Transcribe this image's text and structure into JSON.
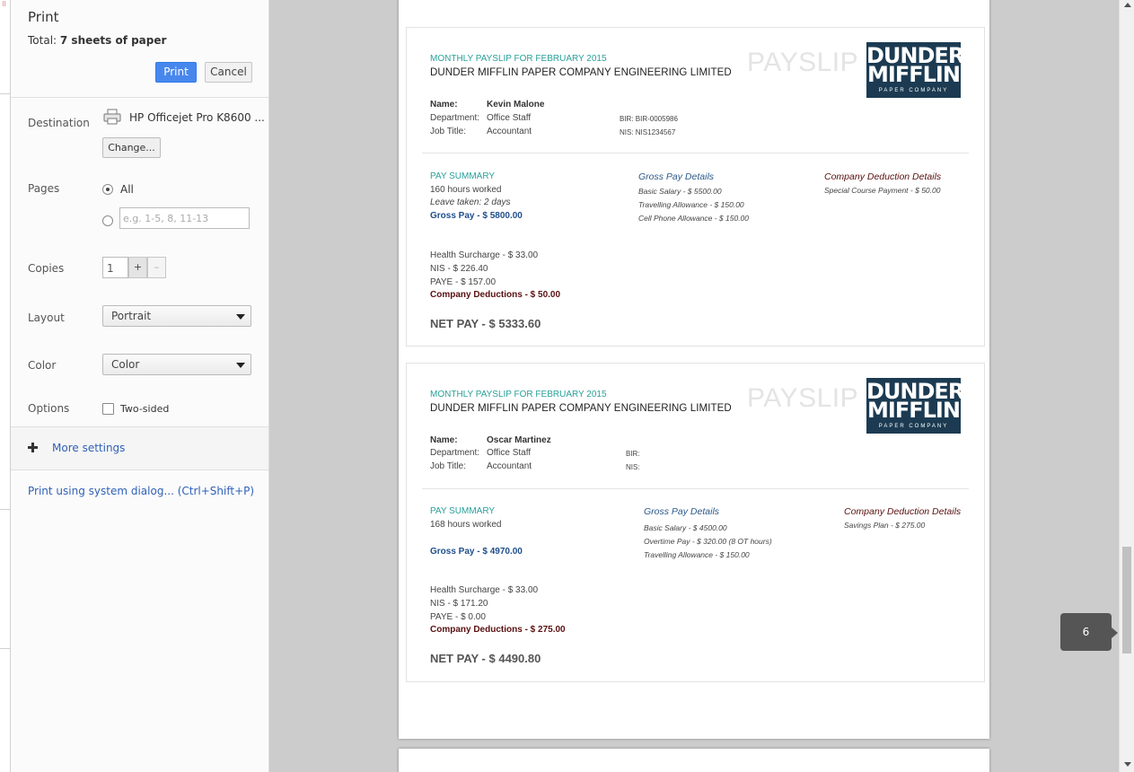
{
  "dialog": {
    "title": "Print",
    "total_label": "Total:",
    "total_value": "7 sheets of paper",
    "print_label": "Print",
    "cancel_label": "Cancel"
  },
  "destination": {
    "label": "Destination",
    "printer": "HP Officejet Pro K8600 ...",
    "change_label": "Change..."
  },
  "pages": {
    "label": "Pages",
    "option_all": "All",
    "custom_placeholder": "e.g. 1-5, 8, 11-13",
    "selected": "All"
  },
  "copies": {
    "label": "Copies",
    "value": "1",
    "plus": "+",
    "minus": "–"
  },
  "layout": {
    "label": "Layout",
    "value": "Portrait"
  },
  "color": {
    "label": "Color",
    "value": "Color"
  },
  "options": {
    "label": "Options",
    "two_sided": "Two-sided",
    "two_sided_checked": false
  },
  "more_settings": "More settings",
  "system_dialog": "Print using system dialog... (Ctrl+Shift+P)",
  "preview": {
    "current_page": "6",
    "slips": [
      {
        "month": "MONTHLY PAYSLIP FOR FEBRUARY 2015",
        "company": "DUNDER MIFFLIN PAPER COMPANY ENGINEERING LIMITED",
        "payslip_word": "PAYSLIP",
        "logo": {
          "line1": "DUNDER",
          "line2": "MIFFLIN",
          "line3": "PAPER COMPANY"
        },
        "name_label": "Name:",
        "name": "Kevin Malone",
        "dept_label": "Department:",
        "dept": "Office Staff",
        "job_label": "Job Title:",
        "job": "Accountant",
        "bir": "BIR: BIR-0005986",
        "nis": "NIS: NIS1234567",
        "pay_summary": "PAY SUMMARY",
        "hours": "160 hours worked",
        "leave": "Leave taken: 2 days",
        "gross_pay": "Gross Pay - $ 5800.00",
        "gross_header": "Gross Pay Details",
        "gross_items": [
          "Basic Salary - $ 5500.00",
          "Travelling Allowance - $ 150.00",
          "Cell Phone Allowance - $ 150.00"
        ],
        "ded_header": "Company Deduction Details",
        "ded_items": [
          "Special Course Payment - $ 50.00"
        ],
        "health": "Health Surcharge - $ 33.00",
        "nis_amt": "NIS - $ 226.40",
        "paye": "PAYE - $ 157.00",
        "company_ded": "Company Deductions - $ 50.00",
        "net_pay": "NET PAY - $ 5333.60"
      },
      {
        "month": "MONTHLY PAYSLIP FOR FEBRUARY 2015",
        "company": "DUNDER MIFFLIN PAPER COMPANY ENGINEERING LIMITED",
        "payslip_word": "PAYSLIP",
        "logo": {
          "line1": "DUNDER",
          "line2": "MIFFLIN",
          "line3": "PAPER COMPANY"
        },
        "name_label": "Name:",
        "name": "Oscar Martinez",
        "dept_label": "Department:",
        "dept": "Office Staff",
        "job_label": "Job Title:",
        "job": "Accountant",
        "bir": "BIR:",
        "nis": "NIS:",
        "pay_summary": "PAY SUMMARY",
        "hours": "168 hours worked",
        "leave": "",
        "gross_pay": "Gross Pay - $ 4970.00",
        "gross_header": "Gross Pay Details",
        "gross_items": [
          "Basic Salary - $ 4500.00",
          "Overtime Pay - $ 320.00 (8 OT hours)",
          "Travelling Allowance - $ 150.00"
        ],
        "ded_header": "Company Deduction Details",
        "ded_items": [
          "Savings Plan - $ 275.00"
        ],
        "health": "Health Surcharge - $ 33.00",
        "nis_amt": "NIS - $ 171.20",
        "paye": "PAYE - $ 0.00",
        "company_ded": "Company Deductions - $ 275.00",
        "net_pay": "NET PAY - $ 4490.80"
      }
    ]
  }
}
